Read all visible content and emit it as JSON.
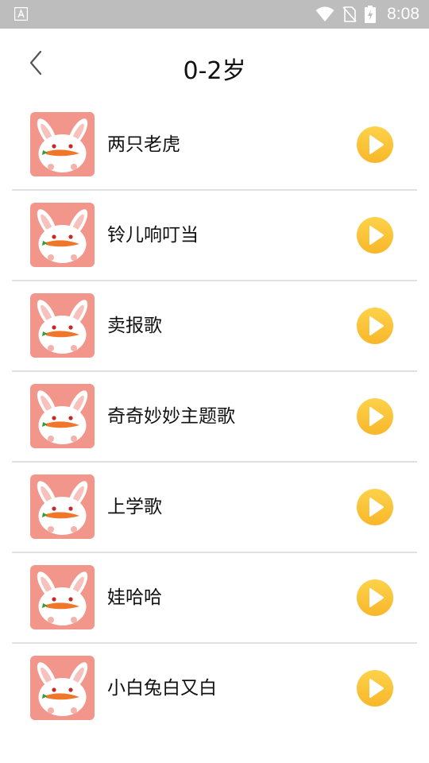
{
  "status_bar": {
    "time": "8:08",
    "icons": [
      "app-notification-icon",
      "wifi-icon",
      "no-sim-icon",
      "battery-charging-icon"
    ]
  },
  "header": {
    "title": "0-2岁",
    "back_icon": "chevron-left-icon"
  },
  "songs": [
    {
      "title": "两只老虎"
    },
    {
      "title": "铃儿响叮当"
    },
    {
      "title": "卖报歌"
    },
    {
      "title": "奇奇妙妙主题歌"
    },
    {
      "title": "上学歌"
    },
    {
      "title": "娃哈哈"
    },
    {
      "title": "小白兔白又白"
    }
  ],
  "colors": {
    "thumbnail_bg": "#f2958a",
    "play_button": "#fcc437",
    "divider": "#e0e0e0",
    "status_bar": "#bdbdbd"
  }
}
